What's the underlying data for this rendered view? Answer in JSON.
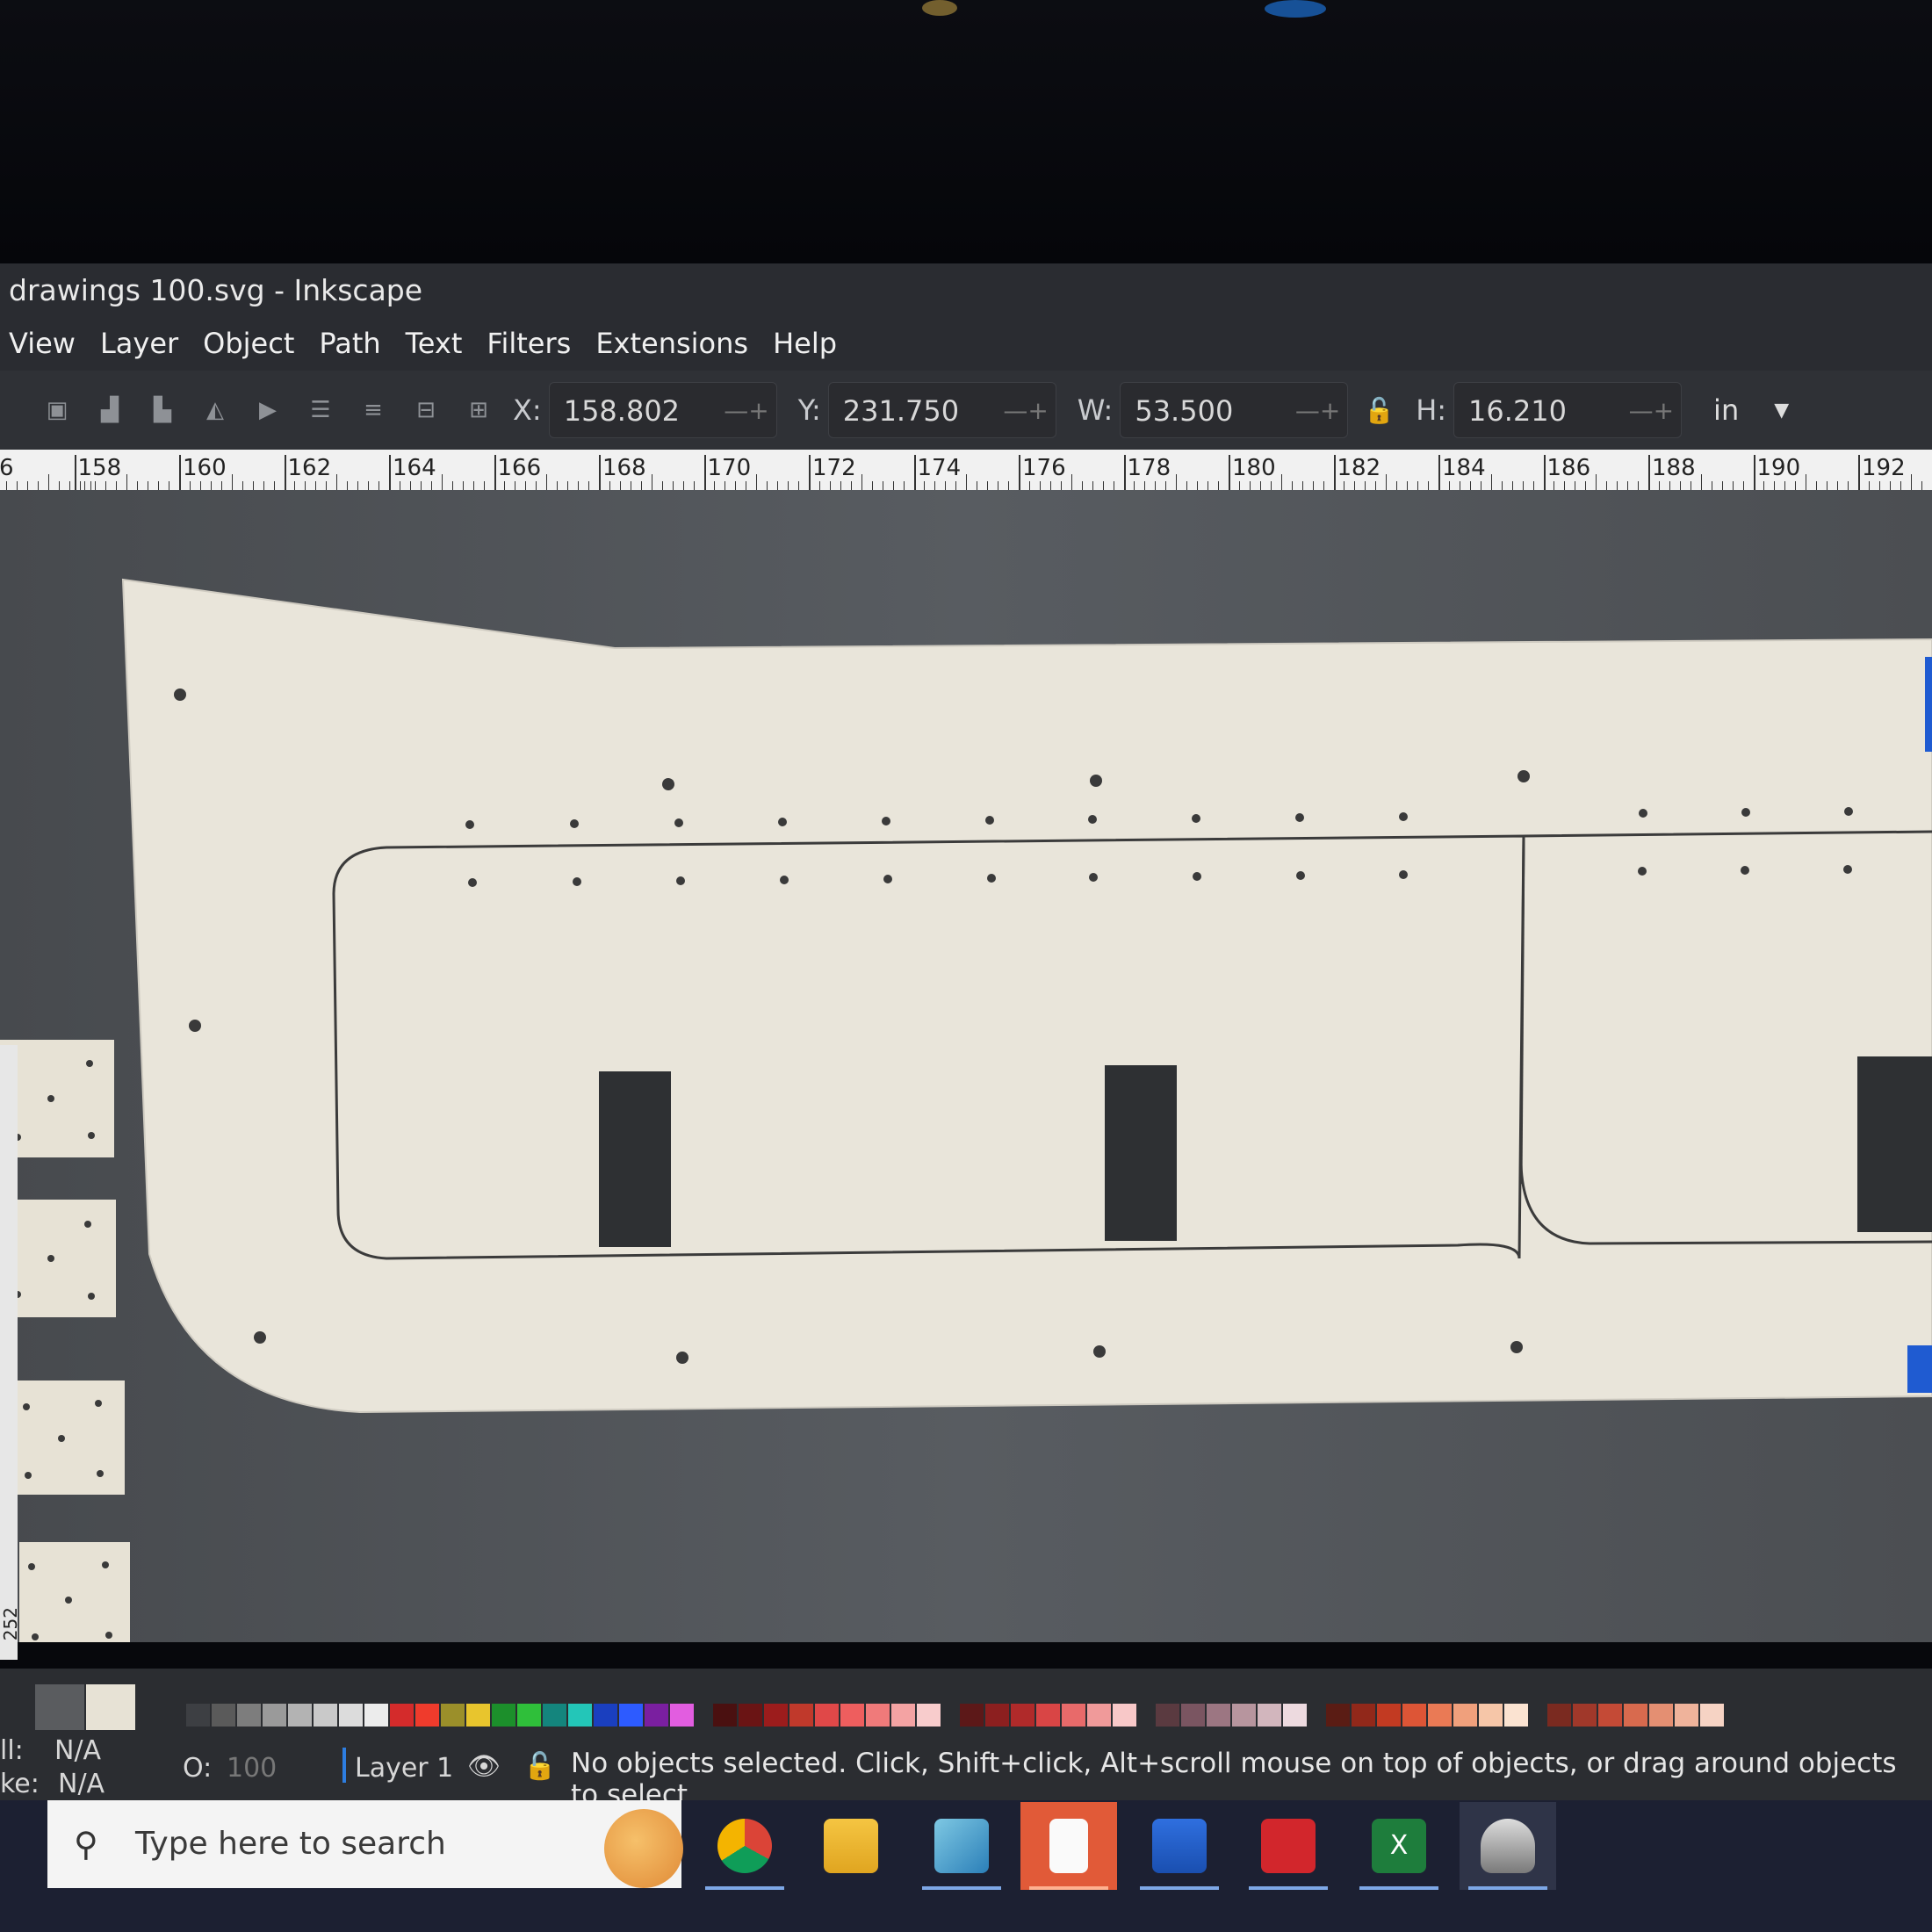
{
  "window": {
    "title": "drawings 100.svg - Inkscape"
  },
  "menu": [
    "View",
    "Layer",
    "Object",
    "Path",
    "Text",
    "Filters",
    "Extensions",
    "Help"
  ],
  "toolbar": {
    "x_label": "X:",
    "x_value": "158.802",
    "y_label": "Y:",
    "y_value": "231.750",
    "w_label": "W:",
    "w_value": "53.500",
    "h_label": "H:",
    "h_value": "16.210",
    "unit": "in",
    "stepper": "—+"
  },
  "ruler": {
    "labels": [
      "6",
      "158",
      "160",
      "162",
      "164",
      "166",
      "168",
      "170",
      "172",
      "174",
      "176",
      "178",
      "180",
      "182",
      "184",
      "186",
      "188",
      "190",
      "192"
    ]
  },
  "vertical_ruler": {
    "label": "252"
  },
  "palette": {
    "colors": [
      "#3d3f43",
      "#5a5a5a",
      "#7d7d7d",
      "#9a9a9a",
      "#b3b3b3",
      "#c9c9c9",
      "#dcdcdc",
      "#ececec",
      "#d42b2b",
      "#ef3b2c",
      "#9b8f2a",
      "#e8c52d",
      "#1c8f2b",
      "#2fbf3a",
      "#14857d",
      "#23c6b8",
      "#1a3fbf",
      "#2d5bff",
      "#7a1fa0",
      "#e25de0",
      "#4a1010",
      "#6a1414",
      "#9c1c1c",
      "#c0392b",
      "#e04848",
      "#ee5e5e",
      "#f07a7a",
      "#f4a3a3",
      "#f8cccc",
      "#5c1818",
      "#8c1f1f",
      "#b02a2a",
      "#d94545",
      "#e86a6a",
      "#f09a9a",
      "#f8c8c8",
      "#5a3a40",
      "#7a5561",
      "#9c7682",
      "#b7959e",
      "#d2b6bd",
      "#eddadf",
      "#5a1c14",
      "#91281a",
      "#c23a22",
      "#dd5536",
      "#ea7a55",
      "#f0a07c",
      "#f6c6a8",
      "#fbe3d1",
      "#7a2a20",
      "#a0382a",
      "#c44a36",
      "#d86a4e",
      "#e48f72",
      "#efb39b",
      "#f6d3c4"
    ]
  },
  "status": {
    "fill_label": "ll:",
    "fill_value": "N/A",
    "stroke_label": "ke:",
    "stroke_value": "N/A",
    "opacity_label": "O:",
    "opacity_value": "100",
    "layer": "Layer 1",
    "message": "No objects selected. Click, Shift+click, Alt+scroll mouse on top of objects, or drag around objects to select."
  },
  "taskbar": {
    "search_placeholder": "Type here to search",
    "apps": [
      "chrome",
      "file-explorer",
      "notepad-app",
      "files-app",
      "calculator",
      "acrobat",
      "excel",
      "inkscape"
    ]
  }
}
